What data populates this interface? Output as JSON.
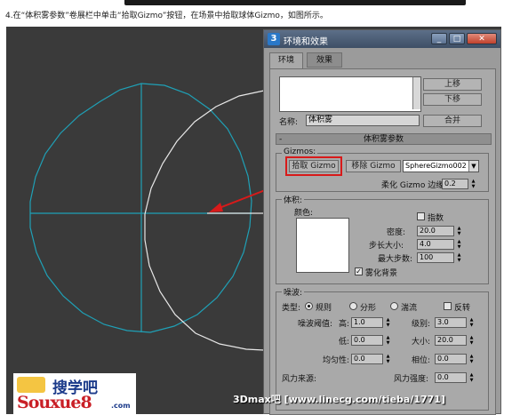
{
  "caption": "4.在“体积雾参数”卷展栏中单击“拾取Gizmo”按钮，在场景中拾取球体Gizmo，如图所示。",
  "window": {
    "title": "环境和效果",
    "logo_glyph": "3",
    "min": "_",
    "max": "□",
    "close": "✕"
  },
  "tabs": [
    "环境",
    "效果"
  ],
  "effects": {
    "move_up": "上移",
    "move_down": "下移",
    "name_label": "名称:",
    "name_value": "体积雾",
    "merge": "合并"
  },
  "rollout": {
    "minus": "-",
    "title": "体积雾参数"
  },
  "gizmos": {
    "group_title": "Gizmos:",
    "pick": "拾取 Gizmo",
    "remove": "移除 Gizmo",
    "selected": "SphereGizmo002",
    "soften_label": "柔化 Gizmo 边缘:",
    "soften_value": "0.2"
  },
  "volume": {
    "group_title": "体积:",
    "color_label": "颜色:",
    "color": "#ffffff",
    "exponential_label": "指数",
    "exponential": false,
    "density_label": "密度:",
    "density": "20.0",
    "step_label": "步长大小:",
    "step": "4.0",
    "maxsteps_label": "最大步数:",
    "maxsteps": "100",
    "fogbg_label": "雾化背景",
    "fogbg": true
  },
  "noise": {
    "group_title": "噪波:",
    "type_label": "类型:",
    "types": [
      "规则",
      "分形",
      "湍流"
    ],
    "selected_type": "规则",
    "invert_label": "反转",
    "threshold_label": "噪波阈值:",
    "high_label": "高:",
    "high": "1.0",
    "level_label": "级别:",
    "level": "3.0",
    "low_label": "低:",
    "low": "0.0",
    "size_label": "大小:",
    "size": "20.0",
    "uniformity_label": "均匀性:",
    "uniformity": "0.0",
    "phase_label": "相位:",
    "phase": "0.0",
    "wind_source_label": "风力来源:",
    "wind_strength_label": "风力强度:",
    "wind_strength": "0.0"
  },
  "logo": {
    "cn": "搜学吧",
    "en": "Souxue8",
    "suffix": ".com"
  },
  "watermark": "3Dmax吧 [www.linecg.com/tieba/1771]",
  "colors": {
    "sphere": "#1fa0b6",
    "gizmo": "#e8e8e8",
    "arrow": "#d81a1a"
  }
}
